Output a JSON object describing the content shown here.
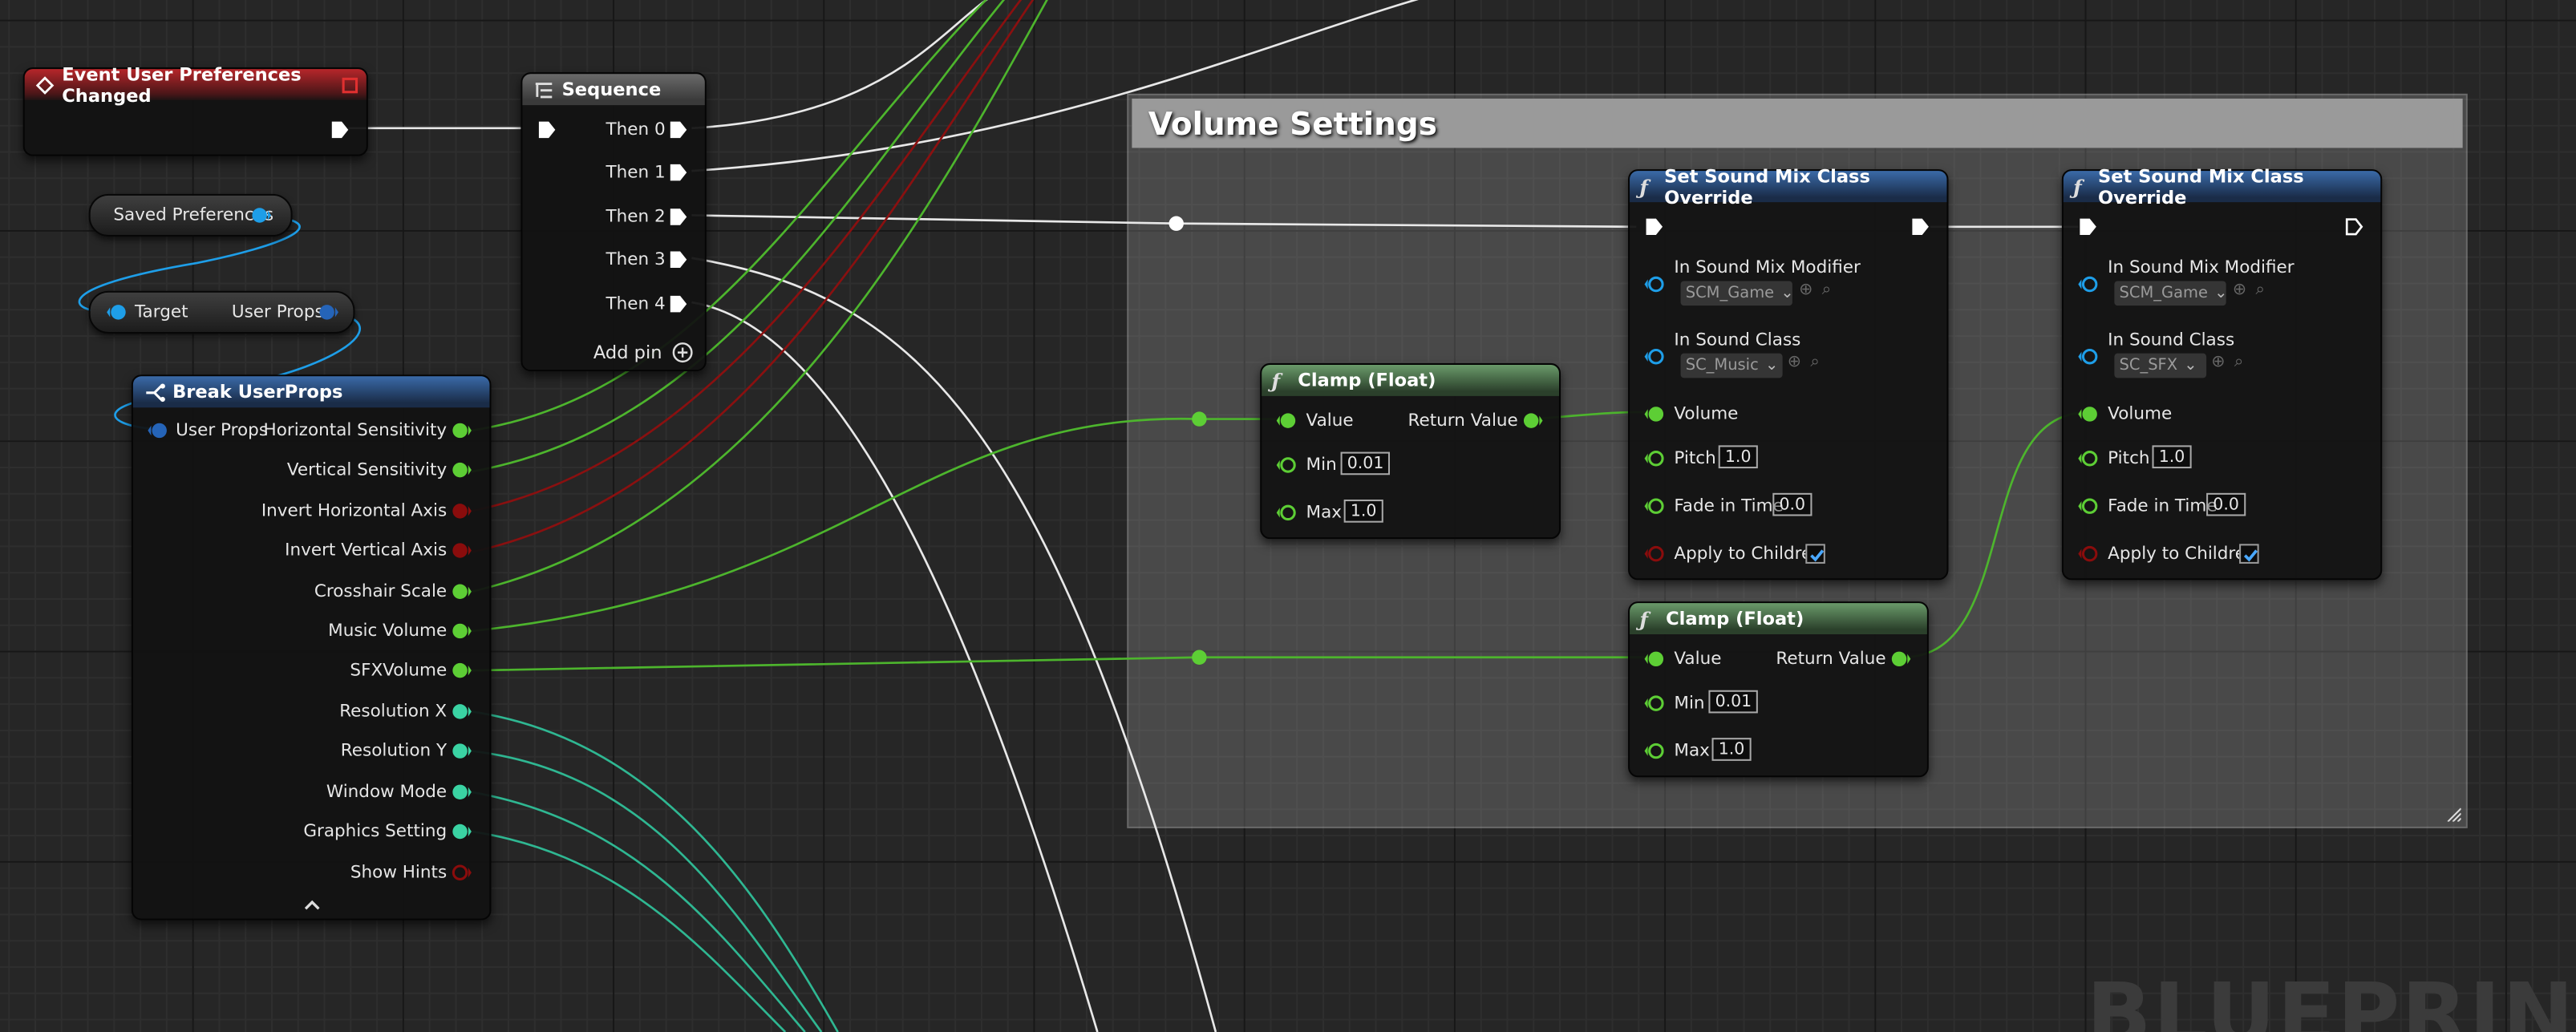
{
  "colors": {
    "exec": "#ffffff",
    "float": "#5dce35",
    "bool": "#7a0b0b",
    "int": "#3ad3a3",
    "object": "#1e9ee8",
    "struct": "#2564b8",
    "comment_bar": "#9a9a9a",
    "grid_bg": "#262626"
  },
  "comment": {
    "title": "Volume Settings"
  },
  "event_node": {
    "title": "Event User Preferences Changed",
    "icon": "event-diamond-icon"
  },
  "saved_preferences": {
    "label": "Saved Preferences"
  },
  "get_user_props": {
    "target": "Target",
    "output": "User Props"
  },
  "sequence": {
    "title": "Sequence",
    "icon": "sequence-icon",
    "pins": [
      "Then 0",
      "Then 1",
      "Then 2",
      "Then 3",
      "Then 4"
    ],
    "add_pin": "Add pin"
  },
  "break_node": {
    "title": "Break UserProps",
    "input": "User Props",
    "pins": [
      "Horizontal Sensitivity",
      "Vertical Sensitivity",
      "Invert Horizontal Axis",
      "Invert Vertical Axis",
      "Crosshair Scale",
      "Music Volume",
      "SFXVolume",
      "Resolution X",
      "Resolution Y",
      "Window Mode",
      "Graphics Setting",
      "Show Hints"
    ]
  },
  "clamp1": {
    "title": "Clamp (Float)",
    "value": "Value",
    "ret": "Return Value",
    "min_label": "Min",
    "min": "0.01",
    "max_label": "Max",
    "max": "1.0"
  },
  "clamp2": {
    "title": "Clamp (Float)",
    "value": "Value",
    "ret": "Return Value",
    "min_label": "Min",
    "min": "0.01",
    "max_label": "Max",
    "max": "1.0"
  },
  "mix1": {
    "title": "Set Sound Mix Class Override",
    "mod_label": "In Sound Mix Modifier",
    "mod": "SCM_Game",
    "class_label": "In Sound Class",
    "class": "SC_Music",
    "volume": "Volume",
    "pitch_label": "Pitch",
    "pitch": "1.0",
    "fade_label": "Fade in Time",
    "fade": "0.0",
    "children": "Apply to Children"
  },
  "mix2": {
    "title": "Set Sound Mix Class Override",
    "mod_label": "In Sound Mix Modifier",
    "mod": "SCM_Game",
    "class_label": "In Sound Class",
    "class": "SC_SFX",
    "volume": "Volume",
    "pitch_label": "Pitch",
    "pitch": "1.0",
    "fade_label": "Fade in Time",
    "fade": "0.0",
    "children": "Apply to Children"
  },
  "watermark": "BLUEPRIN"
}
